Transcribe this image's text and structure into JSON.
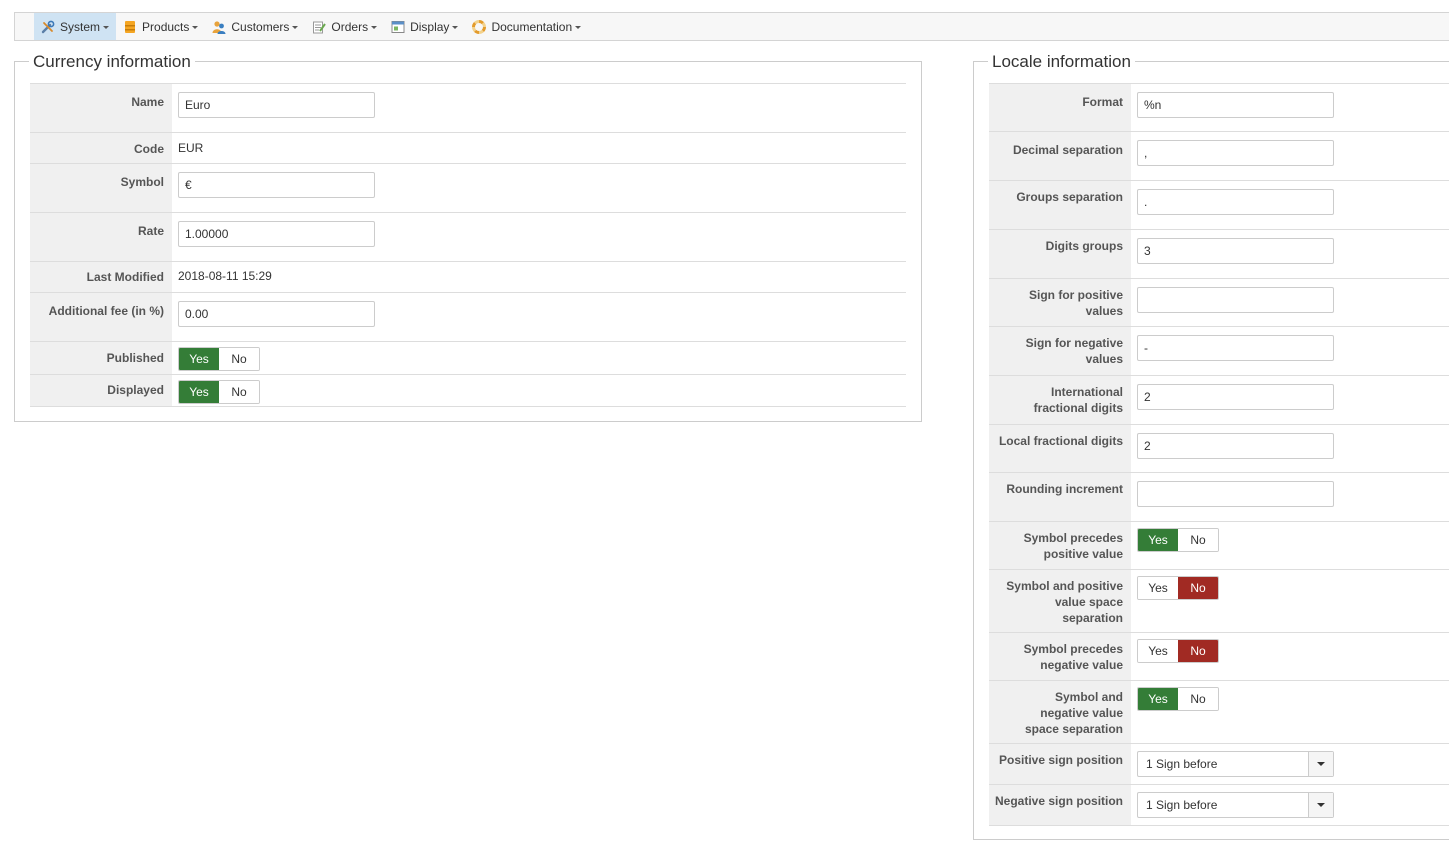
{
  "nav": {
    "items": [
      {
        "label": "System",
        "icon": "tools-icon",
        "active": true
      },
      {
        "label": "Products",
        "icon": "box-icon"
      },
      {
        "label": "Customers",
        "icon": "users-icon"
      },
      {
        "label": "Orders",
        "icon": "orders-icon"
      },
      {
        "label": "Display",
        "icon": "display-icon"
      },
      {
        "label": "Documentation",
        "icon": "lifebuoy-icon"
      }
    ]
  },
  "currency": {
    "title": "Currency information",
    "name_label": "Name",
    "name_value": "Euro",
    "code_label": "Code",
    "code_value": "EUR",
    "symbol_label": "Symbol",
    "symbol_value": "€",
    "rate_label": "Rate",
    "rate_value": "1.00000",
    "modified_label": "Last Modified",
    "modified_value": "2018-08-11 15:29",
    "fee_label": "Additional fee (in %)",
    "fee_value": "0.00",
    "published_label": "Published",
    "published_value": "Yes",
    "displayed_label": "Displayed",
    "displayed_value": "Yes",
    "yes": "Yes",
    "no": "No"
  },
  "locale": {
    "title": "Locale information",
    "format_label": "Format",
    "format_value": "%n",
    "decimal_label": "Decimal separation",
    "decimal_value": ",",
    "groups_label": "Groups separation",
    "groups_value": ".",
    "digits_label": "Digits groups",
    "digits_value": "3",
    "pos_sign_label": "Sign for positive values",
    "pos_sign_value": "",
    "neg_sign_label": "Sign for negative values",
    "neg_sign_value": "-",
    "intl_frac_label": "International fractional digits",
    "intl_frac_value": "2",
    "local_frac_label": "Local fractional digits",
    "local_frac_value": "2",
    "rounding_label": "Rounding increment",
    "rounding_value": "",
    "sym_pre_pos_label": "Symbol precedes positive value",
    "sym_pre_pos_value": "Yes",
    "sym_pos_space_label": "Symbol and positive value space separation",
    "sym_pos_space_value": "No",
    "sym_pre_neg_label": "Symbol precedes negative value",
    "sym_pre_neg_value": "No",
    "sym_neg_space_label": "Symbol and negative value space separation",
    "sym_neg_space_value": "Yes",
    "pos_position_label": "Positive sign position",
    "pos_position_value": "1 Sign before",
    "neg_position_label": "Negative sign position",
    "neg_position_value": "1 Sign before",
    "yes": "Yes",
    "no": "No"
  },
  "colors": {
    "yes_active": "#347d37",
    "no_active": "#a12a23",
    "nav_active": "#cfe3f3"
  }
}
